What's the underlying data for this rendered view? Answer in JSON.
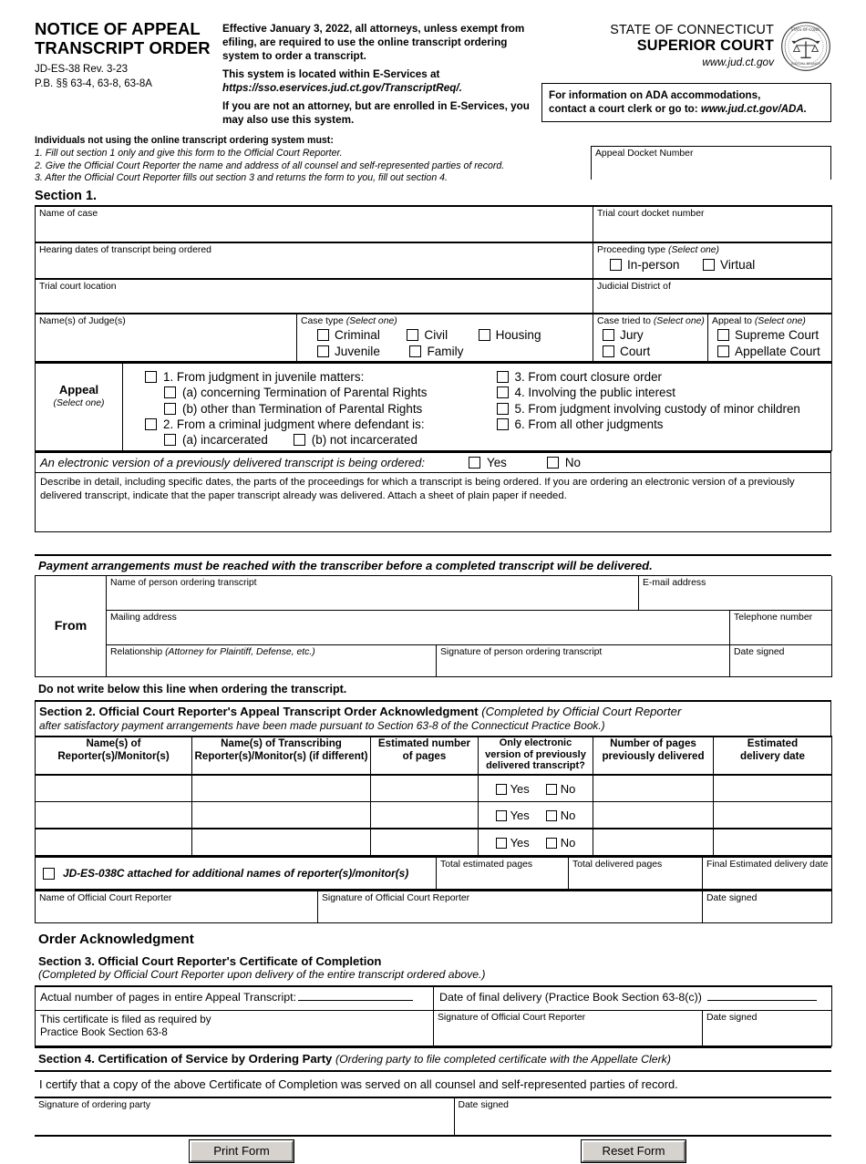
{
  "header": {
    "title_line1": "NOTICE OF APPEAL",
    "title_line2": "TRANSCRIPT ORDER",
    "form_id": "JD-ES-38    Rev. 3-23",
    "practice_book": "P.B. §§ 63-4, 63-8, 63-8A",
    "notice_p1": "Effective January 3, 2022, all attorneys, unless exempt from efiling, are required to use the online transcript ordering system to order a transcript.",
    "notice_p2": "This system is located within E-Services at",
    "notice_url": "https://sso.eservices.jud.ct.gov/TranscriptReq/.",
    "notice_p3": "If you are not an attorney, but are enrolled in E-Services, you may also use this system.",
    "state": "STATE OF CONNECTICUT",
    "court": "SUPERIOR COURT",
    "website": "www.jud.ct.gov",
    "ada_line1": "For information on ADA accommodations,",
    "ada_line2_plain": "contact a court clerk or go to: ",
    "ada_line2_url": "www.jud.ct.gov/ADA."
  },
  "instructions": {
    "heading": "Individuals not using the online transcript ordering system must:",
    "items": [
      "1. Fill out section 1 only and give this form to the Official Court Reporter.",
      "2. Give the Official Court Reporter the name and address of all counsel and self-represented parties of record.",
      "3. After the Official Court Reporter fills out section 3 and returns the form to you, fill out section 4."
    ]
  },
  "section1": {
    "heading": "Section 1.",
    "appeal_docket_number": "Appeal Docket Number",
    "name_of_case": "Name of case",
    "trial_court_docket_number": "Trial court docket number",
    "hearing_dates": "Hearing dates of transcript being ordered",
    "proceeding_type_label": "Proceeding type",
    "select_one": "(Select one)",
    "proceeding_options": [
      "In-person",
      "Virtual"
    ],
    "trial_court_location": "Trial court location",
    "judicial_district_of": "Judicial District of",
    "names_of_judges": "Name(s) of Judge(s)",
    "case_type_label": "Case type",
    "case_type_options": [
      "Criminal",
      "Civil",
      "Housing",
      "Juvenile",
      "Family"
    ],
    "case_tried_to_label": "Case tried to",
    "case_tried_to_options": [
      "Jury",
      "Court"
    ],
    "appeal_to_label": "Appeal to",
    "appeal_to_options": [
      "Supreme Court",
      "Appellate Court"
    ]
  },
  "appeal": {
    "label": "Appeal",
    "sublabel": "(Select one)",
    "left_items": [
      "1. From judgment in juvenile matters:",
      "(a) concerning Termination of Parental Rights",
      "(b) other than Termination of Parental Rights",
      "2. From a criminal judgment where defendant is:",
      "(a) incarcerated",
      "(b) not incarcerated"
    ],
    "right_items": [
      "3. From court closure order",
      "4. Involving the public interest",
      "5. From judgment involving custody of minor children",
      "6. From all other judgments"
    ]
  },
  "electronic": {
    "question": "An electronic version of a previously delivered transcript is being ordered:",
    "yes": "Yes",
    "no": "No"
  },
  "describe": {
    "text": "Describe in detail, including specific dates, the parts of the proceedings for which a transcript is being ordered. If you are ordering an electronic version of a previously delivered transcript, indicate that the paper transcript already was delivered. Attach a sheet of plain paper if needed."
  },
  "payment_notice": "Payment arrangements must be reached with the transcriber before a completed transcript will be delivered.",
  "from_block": {
    "label": "From",
    "name_of_person": "Name of person ordering transcript",
    "email_address": "E-mail address",
    "mailing_address": "Mailing address",
    "telephone_number": "Telephone number",
    "relationship_plain": "Relationship ",
    "relationship_italic": "(Attorney for Plaintiff, Defense, etc.)",
    "signature": "Signature of person ordering transcript",
    "date_signed": "Date signed"
  },
  "do_not_write": "Do not write below this line when ordering the transcript.",
  "section2": {
    "heading_bold": "Section 2. Official Court Reporter's Appeal Transcript Order Acknowledgment ",
    "heading_italic": "(Completed by Official Court Reporter",
    "heading_line2": "after satisfactory payment arrangements have been made pursuant to Section 63-8 of the Connecticut Practice Book.)",
    "columns": [
      "Name(s) of\nReporter(s)/Monitor(s)",
      "Name(s) of Transcribing\nReporter(s)/Monitor(s) (if different)",
      "Estimated number\nof pages",
      "Only electronic\nversion of previously\ndelivered transcript?",
      "Number of pages\npreviously delivered",
      "Estimated\ndelivery date"
    ],
    "rows": [
      {
        "yes": "Yes",
        "no": "No"
      },
      {
        "yes": "Yes",
        "no": "No"
      },
      {
        "yes": "Yes",
        "no": "No"
      }
    ],
    "attached_checkbox_label": "JD-ES-038C attached for additional names of reporter(s)/monitor(s)",
    "total_estimated_pages": "Total estimated pages",
    "total_delivered_pages": "Total delivered pages",
    "final_estimated_delivery_date": "Final Estimated delivery date",
    "name_of_reporter": "Name of Official Court Reporter",
    "signature_of_reporter": "Signature of Official Court Reporter",
    "date_signed": "Date signed"
  },
  "order_acknowledgment": "Order Acknowledgment",
  "section3": {
    "heading": "Section 3. Official Court Reporter's Certificate of Completion",
    "subheading": "(Completed by Official Court Reporter upon delivery of the entire transcript ordered above.)",
    "actual_pages_label": "Actual number of pages in entire Appeal Transcript:",
    "final_delivery_label": "Date of final delivery (Practice Book Section 63-8(c))",
    "certificate_filed_line1": "This certificate is filed as required by",
    "certificate_filed_line2": "Practice Book Section 63-8",
    "signature_of_reporter": "Signature of Official Court Reporter",
    "date_signed": "Date signed"
  },
  "section4": {
    "heading_bold": "Section 4. Certification of Service by Ordering Party ",
    "heading_italic": "(Ordering party to file completed certificate with the Appellate Clerk)",
    "certify_text": "I certify that a copy of the above Certificate of Completion was served on all counsel and self-represented parties of record.",
    "signature_label": "Signature of ordering party",
    "date_signed": "Date signed"
  },
  "buttons": {
    "print": "Print Form",
    "reset": "Reset Form"
  }
}
